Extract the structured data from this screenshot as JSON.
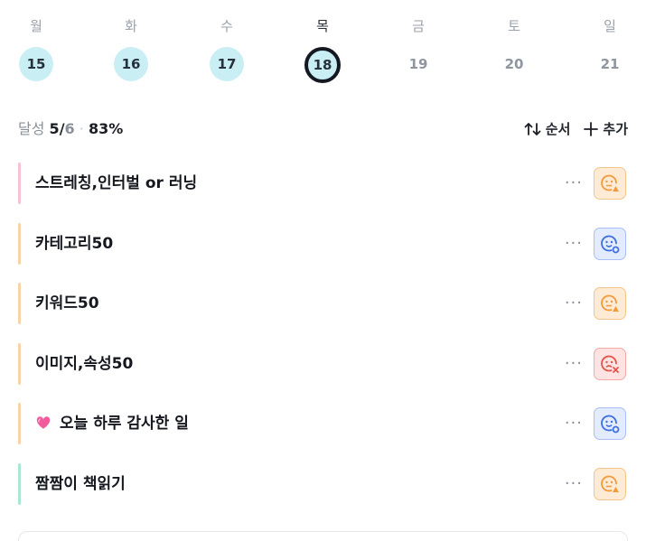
{
  "week": {
    "days": [
      {
        "label": "월",
        "num": "15",
        "state": "done"
      },
      {
        "label": "화",
        "num": "16",
        "state": "done"
      },
      {
        "label": "수",
        "num": "17",
        "state": "done"
      },
      {
        "label": "목",
        "num": "18",
        "state": "today"
      },
      {
        "label": "금",
        "num": "19",
        "state": "future"
      },
      {
        "label": "토",
        "num": "20",
        "state": "future"
      },
      {
        "label": "일",
        "num": "21",
        "state": "future"
      }
    ]
  },
  "summary": {
    "label": "달성",
    "done": "5",
    "slash": "/",
    "total": "6",
    "dot": "·",
    "percent": "83%",
    "sort_label": "순서",
    "add_label": "추가"
  },
  "items": [
    {
      "title": "스트레칭,인터벌 or 러닝",
      "bar_color": "#f7c2d3",
      "status": "warn",
      "status_icon": "face-warning-icon",
      "more": "···"
    },
    {
      "title": "카테고리50",
      "bar_color": "#f8d3a8",
      "status": "ok",
      "status_icon": "face-check-icon",
      "more": "···"
    },
    {
      "title": "키워드50",
      "bar_color": "#f8d3a8",
      "status": "warn",
      "status_icon": "face-warning-icon",
      "more": "···"
    },
    {
      "title": "이미지,속성50",
      "bar_color": "#f8d3a8",
      "status": "fail",
      "status_icon": "face-x-icon",
      "more": "···"
    },
    {
      "title": "오늘 하루 감사한 일",
      "emoji": "heart-icon",
      "bar_color": "#f8d3a8",
      "status": "ok",
      "status_icon": "face-check-icon",
      "more": "···"
    },
    {
      "title": "짬짬이 책읽기",
      "bar_color": "#a9e7cf",
      "status": "warn",
      "status_icon": "face-warning-icon",
      "more": "···"
    }
  ],
  "colors": {
    "accent_cyan": "#c9eef4",
    "warn": "#f39a3d",
    "ok": "#3f6fe0",
    "fail": "#e2564b"
  }
}
